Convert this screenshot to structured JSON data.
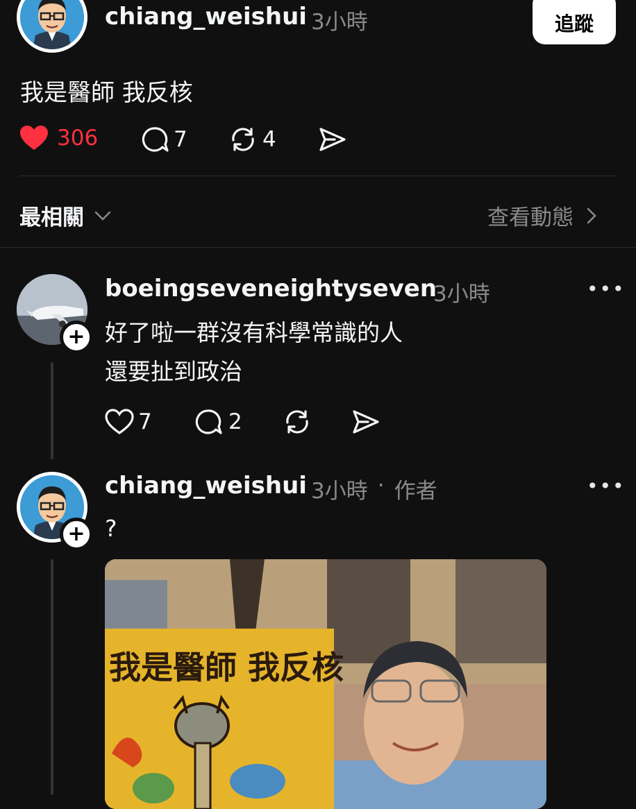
{
  "post": {
    "username": "chiang_weishui",
    "time": "3小時",
    "follow_label": "追蹤",
    "text": "我是醫師 我反核",
    "likes": "306",
    "comments": "7",
    "reposts": "4",
    "like_color": "#ff3040"
  },
  "sort": {
    "label": "最相關",
    "view_activity": "查看動態"
  },
  "replies": [
    {
      "username": "boeingseveneightyseven",
      "time": "3小時",
      "lines": [
        "好了啦一群沒有科學常識的人",
        "還要扯到政治"
      ],
      "likes": "7",
      "comments": "2"
    },
    {
      "username": "chiang_weishui",
      "time": "3小時",
      "separator": "·",
      "author_tag": "作者",
      "text": "?",
      "image": {
        "sign_text": "我是醫師 我反核",
        "description": "protest-photo"
      }
    }
  ]
}
